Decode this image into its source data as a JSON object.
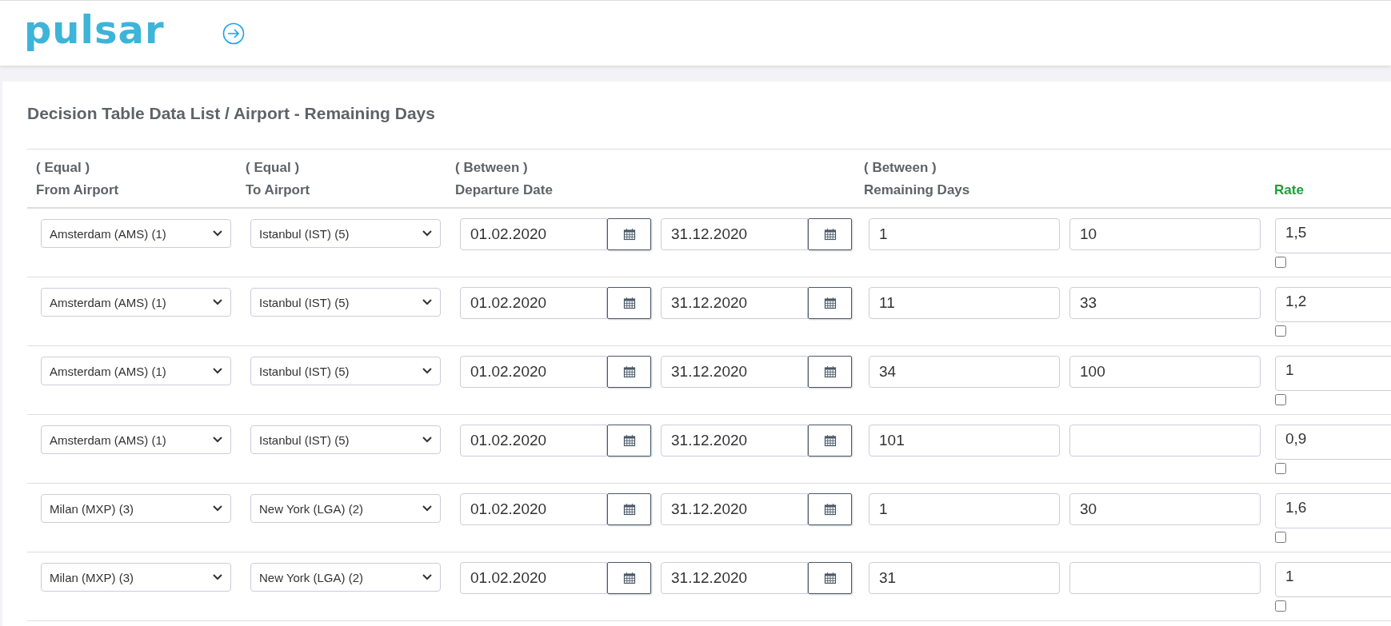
{
  "header": {
    "logo": "pulsar"
  },
  "page_title": "Decision Table Data List / Airport - Remaining Days",
  "columns": [
    {
      "kind": "filter",
      "operator": "( Equal )",
      "label": "From Airport"
    },
    {
      "kind": "filter",
      "operator": "( Equal )",
      "label": "To Airport"
    },
    {
      "kind": "filter",
      "operator": "( Between )",
      "label": "Departure Date"
    },
    {
      "kind": "filter",
      "operator": "( Between )",
      "label": "Remaining Days"
    },
    {
      "kind": "result",
      "label": "Rate"
    }
  ],
  "rows": [
    {
      "from": "Amsterdam (AMS) (1)",
      "to": "Istanbul (IST) (5)",
      "date_from": "01.02.2020",
      "date_to": "31.12.2020",
      "days_from": "1",
      "days_to": "10",
      "rate": "1,5",
      "checked": false
    },
    {
      "from": "Amsterdam (AMS) (1)",
      "to": "Istanbul (IST) (5)",
      "date_from": "01.02.2020",
      "date_to": "31.12.2020",
      "days_from": "11",
      "days_to": "33",
      "rate": "1,2",
      "checked": false
    },
    {
      "from": "Amsterdam (AMS) (1)",
      "to": "Istanbul (IST) (5)",
      "date_from": "01.02.2020",
      "date_to": "31.12.2020",
      "days_from": "34",
      "days_to": "100",
      "rate": "1",
      "checked": false
    },
    {
      "from": "Amsterdam (AMS) (1)",
      "to": "Istanbul (IST) (5)",
      "date_from": "01.02.2020",
      "date_to": "31.12.2020",
      "days_from": "101",
      "rate": "0,9",
      "checked": false
    },
    {
      "from": "Milan (MXP) (3)",
      "to": "New York (LGA) (2)",
      "date_from": "01.02.2020",
      "date_to": "31.12.2020",
      "days_from": "1",
      "days_to": "30",
      "rate": "1,6",
      "checked": false
    },
    {
      "from": "Milan (MXP) (3)",
      "to": "New York (LGA) (2)",
      "date_from": "01.02.2020",
      "date_to": "31.12.2020",
      "days_from": "31",
      "rate": "1",
      "checked": false
    }
  ]
}
